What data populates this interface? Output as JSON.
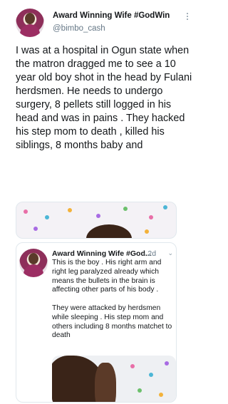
{
  "tweet": {
    "author_name": "Award Winning Wife #GodWin",
    "handle": "@bimbo_cash",
    "text": "I was at a hospital in Ogun state when the matron dragged me to see a 10 year old boy shot in the head by Fulani herdsmen. He needs to undergo surgery, 8 pellets still logged in his head and was in pains . They hacked his step mom to death , killed his siblings, 8 months baby and"
  },
  "quoted_tweet": {
    "author_name": "Award Winning Wife #God...",
    "time": "· 2d",
    "text": "This is the boy . His right arm and right leg paralyzed already which means the bullets in the brain is affecting other parts of his body .\n\nThey were attacked by herdsmen while sleeping . His step mom and others including 8 months matchet to death"
  },
  "icons": {
    "more": "more-vertical-icon",
    "chevron": "chevron-down-icon"
  }
}
